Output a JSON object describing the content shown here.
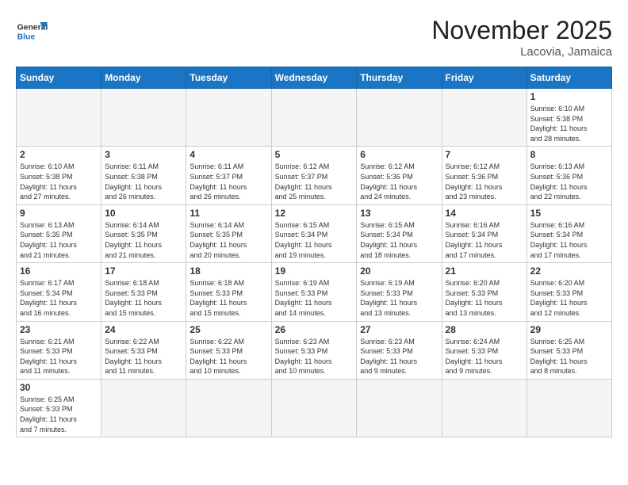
{
  "header": {
    "logo_general": "General",
    "logo_blue": "Blue",
    "month_title": "November 2025",
    "location": "Lacovia, Jamaica"
  },
  "days_of_week": [
    "Sunday",
    "Monday",
    "Tuesday",
    "Wednesday",
    "Thursday",
    "Friday",
    "Saturday"
  ],
  "weeks": [
    [
      {
        "day": "",
        "info": ""
      },
      {
        "day": "",
        "info": ""
      },
      {
        "day": "",
        "info": ""
      },
      {
        "day": "",
        "info": ""
      },
      {
        "day": "",
        "info": ""
      },
      {
        "day": "",
        "info": ""
      },
      {
        "day": "1",
        "info": "Sunrise: 6:10 AM\nSunset: 5:38 PM\nDaylight: 11 hours\nand 28 minutes."
      }
    ],
    [
      {
        "day": "2",
        "info": "Sunrise: 6:10 AM\nSunset: 5:38 PM\nDaylight: 11 hours\nand 27 minutes."
      },
      {
        "day": "3",
        "info": "Sunrise: 6:11 AM\nSunset: 5:38 PM\nDaylight: 11 hours\nand 26 minutes."
      },
      {
        "day": "4",
        "info": "Sunrise: 6:11 AM\nSunset: 5:37 PM\nDaylight: 11 hours\nand 26 minutes."
      },
      {
        "day": "5",
        "info": "Sunrise: 6:12 AM\nSunset: 5:37 PM\nDaylight: 11 hours\nand 25 minutes."
      },
      {
        "day": "6",
        "info": "Sunrise: 6:12 AM\nSunset: 5:36 PM\nDaylight: 11 hours\nand 24 minutes."
      },
      {
        "day": "7",
        "info": "Sunrise: 6:12 AM\nSunset: 5:36 PM\nDaylight: 11 hours\nand 23 minutes."
      },
      {
        "day": "8",
        "info": "Sunrise: 6:13 AM\nSunset: 5:36 PM\nDaylight: 11 hours\nand 22 minutes."
      }
    ],
    [
      {
        "day": "9",
        "info": "Sunrise: 6:13 AM\nSunset: 5:35 PM\nDaylight: 11 hours\nand 21 minutes."
      },
      {
        "day": "10",
        "info": "Sunrise: 6:14 AM\nSunset: 5:35 PM\nDaylight: 11 hours\nand 21 minutes."
      },
      {
        "day": "11",
        "info": "Sunrise: 6:14 AM\nSunset: 5:35 PM\nDaylight: 11 hours\nand 20 minutes."
      },
      {
        "day": "12",
        "info": "Sunrise: 6:15 AM\nSunset: 5:34 PM\nDaylight: 11 hours\nand 19 minutes."
      },
      {
        "day": "13",
        "info": "Sunrise: 6:15 AM\nSunset: 5:34 PM\nDaylight: 11 hours\nand 18 minutes."
      },
      {
        "day": "14",
        "info": "Sunrise: 6:16 AM\nSunset: 5:34 PM\nDaylight: 11 hours\nand 17 minutes."
      },
      {
        "day": "15",
        "info": "Sunrise: 6:16 AM\nSunset: 5:34 PM\nDaylight: 11 hours\nand 17 minutes."
      }
    ],
    [
      {
        "day": "16",
        "info": "Sunrise: 6:17 AM\nSunset: 5:34 PM\nDaylight: 11 hours\nand 16 minutes."
      },
      {
        "day": "17",
        "info": "Sunrise: 6:18 AM\nSunset: 5:33 PM\nDaylight: 11 hours\nand 15 minutes."
      },
      {
        "day": "18",
        "info": "Sunrise: 6:18 AM\nSunset: 5:33 PM\nDaylight: 11 hours\nand 15 minutes."
      },
      {
        "day": "19",
        "info": "Sunrise: 6:19 AM\nSunset: 5:33 PM\nDaylight: 11 hours\nand 14 minutes."
      },
      {
        "day": "20",
        "info": "Sunrise: 6:19 AM\nSunset: 5:33 PM\nDaylight: 11 hours\nand 13 minutes."
      },
      {
        "day": "21",
        "info": "Sunrise: 6:20 AM\nSunset: 5:33 PM\nDaylight: 11 hours\nand 13 minutes."
      },
      {
        "day": "22",
        "info": "Sunrise: 6:20 AM\nSunset: 5:33 PM\nDaylight: 11 hours\nand 12 minutes."
      }
    ],
    [
      {
        "day": "23",
        "info": "Sunrise: 6:21 AM\nSunset: 5:33 PM\nDaylight: 11 hours\nand 11 minutes."
      },
      {
        "day": "24",
        "info": "Sunrise: 6:22 AM\nSunset: 5:33 PM\nDaylight: 11 hours\nand 11 minutes."
      },
      {
        "day": "25",
        "info": "Sunrise: 6:22 AM\nSunset: 5:33 PM\nDaylight: 11 hours\nand 10 minutes."
      },
      {
        "day": "26",
        "info": "Sunrise: 6:23 AM\nSunset: 5:33 PM\nDaylight: 11 hours\nand 10 minutes."
      },
      {
        "day": "27",
        "info": "Sunrise: 6:23 AM\nSunset: 5:33 PM\nDaylight: 11 hours\nand 9 minutes."
      },
      {
        "day": "28",
        "info": "Sunrise: 6:24 AM\nSunset: 5:33 PM\nDaylight: 11 hours\nand 9 minutes."
      },
      {
        "day": "29",
        "info": "Sunrise: 6:25 AM\nSunset: 5:33 PM\nDaylight: 11 hours\nand 8 minutes."
      }
    ],
    [
      {
        "day": "30",
        "info": "Sunrise: 6:25 AM\nSunset: 5:33 PM\nDaylight: 11 hours\nand 7 minutes."
      },
      {
        "day": "",
        "info": ""
      },
      {
        "day": "",
        "info": ""
      },
      {
        "day": "",
        "info": ""
      },
      {
        "day": "",
        "info": ""
      },
      {
        "day": "",
        "info": ""
      },
      {
        "day": "",
        "info": ""
      }
    ]
  ]
}
